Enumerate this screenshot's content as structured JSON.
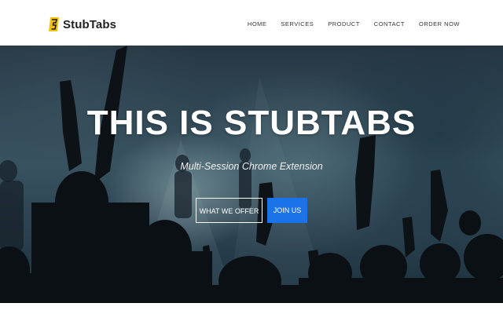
{
  "brand": {
    "name": "StubTabs",
    "logo_icon": "stubtabs-logo-icon",
    "logo_color": "#f4c20d"
  },
  "nav": {
    "items": [
      "HOME",
      "SERVICES",
      "PRODUCT",
      "CONTACT",
      "ORDER NOW"
    ]
  },
  "hero": {
    "title": "THIS IS STUBTABS",
    "subtitle": "Multi-Session Chrome Extension",
    "primary_button": "WHAT WE OFFER",
    "secondary_button": "JOIN US",
    "accent_color": "#1a73e8"
  }
}
